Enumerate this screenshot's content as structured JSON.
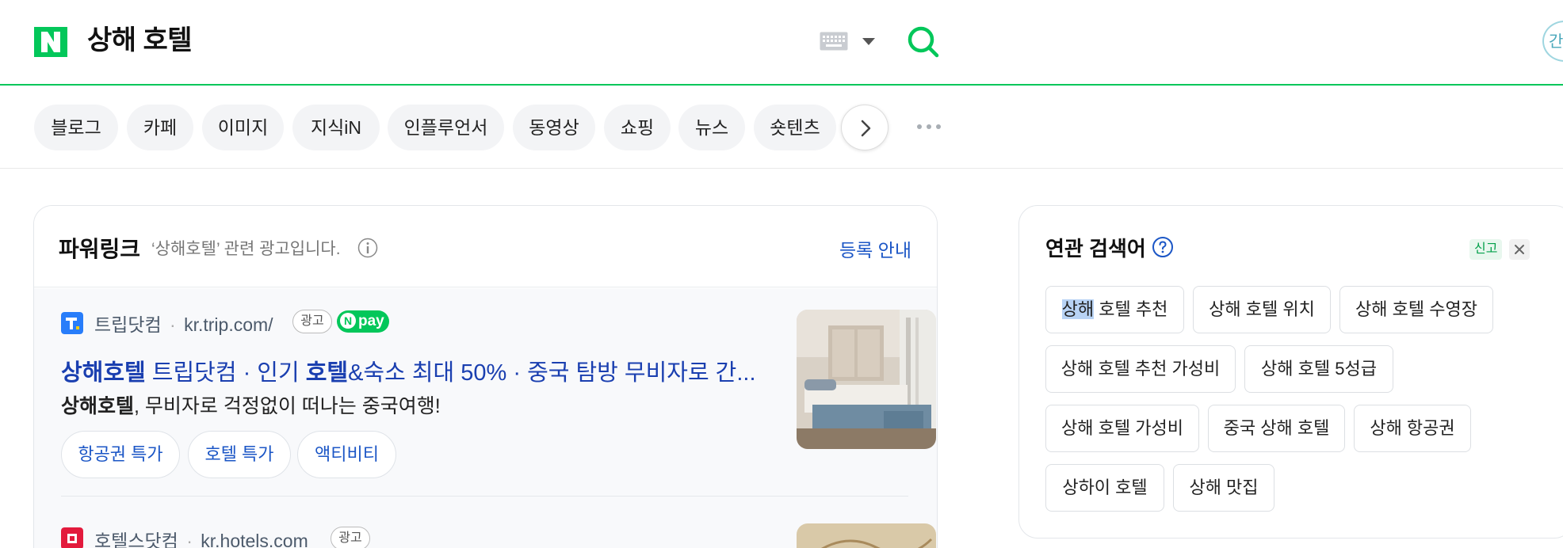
{
  "header": {
    "query": "상해 호텔",
    "corner_badge_text": "간"
  },
  "tabs": [
    "블로그",
    "카페",
    "이미지",
    "지식iN",
    "인플루언서",
    "동영상",
    "쇼핑",
    "뉴스",
    "숏텐츠"
  ],
  "powerlink": {
    "title": "파워링크",
    "subtitle": "‘상해호텔’ 관련 광고입니다.",
    "register_label": "등록 안내",
    "ads": [
      {
        "site_name": "트립닷컴",
        "url": "kr.trip.com/",
        "ad_label": "광고",
        "npay_label": "pay",
        "npay_n": "N",
        "title_bold1": "상해호텔",
        "title_rest1": " 트립닷컴 · 인기 ",
        "title_bold2": "호텔",
        "title_rest2": "&숙소 최대 50% · 중국 탐방 무비자로 간...",
        "desc_bold": "상해호텔",
        "desc_rest": ", 무비자로 걱정없이 떠나는 중국여행!",
        "sublinks": [
          "항공권 특가",
          "호텔 특가",
          "액티비티"
        ]
      },
      {
        "site_name": "호텔스닷컴",
        "url": "kr.hotels.com",
        "ad_label": "광고"
      }
    ],
    "separator": "·"
  },
  "related": {
    "title": "연관 검색어",
    "report_label": "신고",
    "chips": [
      {
        "hl": "상해",
        "rest": " 호텔 추천"
      },
      {
        "hl": "",
        "rest": "상해 호텔 위치"
      },
      {
        "hl": "",
        "rest": "상해 호텔 수영장"
      },
      {
        "hl": "",
        "rest": "상해 호텔 추천 가성비"
      },
      {
        "hl": "",
        "rest": "상해 호텔 5성급"
      },
      {
        "hl": "",
        "rest": "상해 호텔 가성비"
      },
      {
        "hl": "",
        "rest": "중국 상해 호텔"
      },
      {
        "hl": "",
        "rest": "상해 항공권"
      },
      {
        "hl": "",
        "rest": "상하이 호텔"
      },
      {
        "hl": "",
        "rest": "상해 맛집"
      }
    ]
  },
  "colors": {
    "brand_green": "#03c75a",
    "link_blue": "#1b56c6",
    "title_blue": "#1a3fb0"
  },
  "icons": [
    "naver-logo",
    "keyboard-icon",
    "search-icon",
    "info-icon",
    "help-icon",
    "close-icon",
    "chevron-right-icon",
    "more-icon"
  ]
}
